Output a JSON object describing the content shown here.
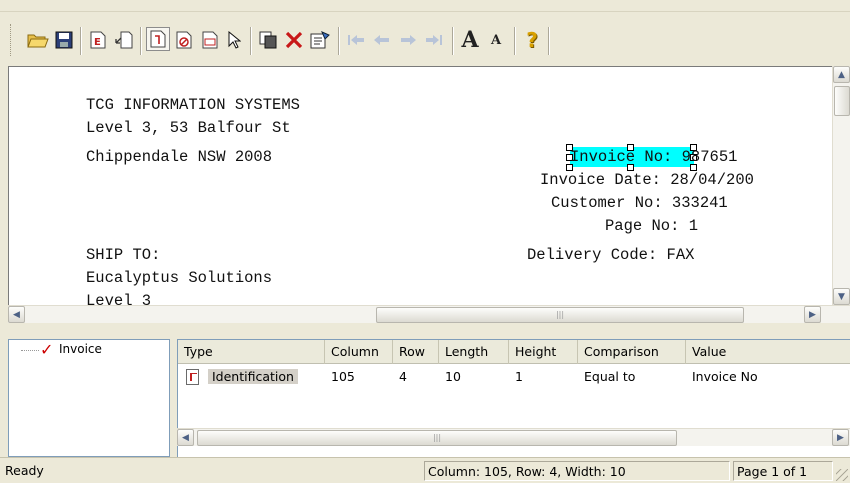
{
  "toolbar": {
    "buttons": [
      {
        "name": "open-folder-icon",
        "enabled": true
      },
      {
        "name": "save-icon",
        "enabled": true
      },
      {
        "name": "document-e-icon",
        "enabled": true
      },
      {
        "name": "import-icon",
        "enabled": true
      },
      {
        "name": "identification-field-icon",
        "enabled": true,
        "pressed": true
      },
      {
        "name": "exclude-field-icon",
        "enabled": true
      },
      {
        "name": "data-field-icon",
        "enabled": true
      },
      {
        "name": "pointer-icon",
        "enabled": true
      },
      {
        "name": "copy-icon",
        "enabled": true
      },
      {
        "name": "delete-icon",
        "enabled": true
      },
      {
        "name": "properties-icon",
        "enabled": true
      },
      {
        "name": "first-page-icon",
        "enabled": false
      },
      {
        "name": "previous-page-icon",
        "enabled": false
      },
      {
        "name": "next-page-icon",
        "enabled": false
      },
      {
        "name": "last-page-icon",
        "enabled": false
      },
      {
        "name": "increase-font-icon",
        "enabled": true
      },
      {
        "name": "decrease-font-icon",
        "enabled": true
      },
      {
        "name": "help-icon",
        "enabled": true
      }
    ],
    "font_big_glyph": "A",
    "font_small_glyph": "A",
    "help_glyph": "?"
  },
  "document": {
    "lines": [
      "TCG INFORMATION SYSTEMS",
      "Level 3, 53 Balfour St",
      "Chippendale NSW 2008",
      "Invoice No: 987651",
      "Invoice Date: 28/04/200",
      "Customer No: 333241",
      "Page No: 1",
      "Delivery Code: FAX",
      "SHIP TO:",
      "Eucalyptus Solutions",
      "Level 3"
    ],
    "highlight_color": "#00ffff"
  },
  "tree": {
    "items": [
      {
        "label": "Invoice",
        "checked": true
      }
    ]
  },
  "grid": {
    "columns": [
      "Type",
      "Column",
      "Row",
      "Length",
      "Height",
      "Comparison",
      "Value"
    ],
    "rows": [
      {
        "type": "Identification",
        "column": "105",
        "row": "4",
        "length": "10",
        "height": "1",
        "comparison": "Equal to",
        "value": "Invoice No"
      }
    ]
  },
  "status": {
    "text": "Ready",
    "position": "Column: 105, Row: 4, Width: 10",
    "page": "Page 1 of 1"
  },
  "colors": {
    "chrome": "#ece9d8",
    "selection": "#00ffff",
    "check": "#cc0000"
  }
}
